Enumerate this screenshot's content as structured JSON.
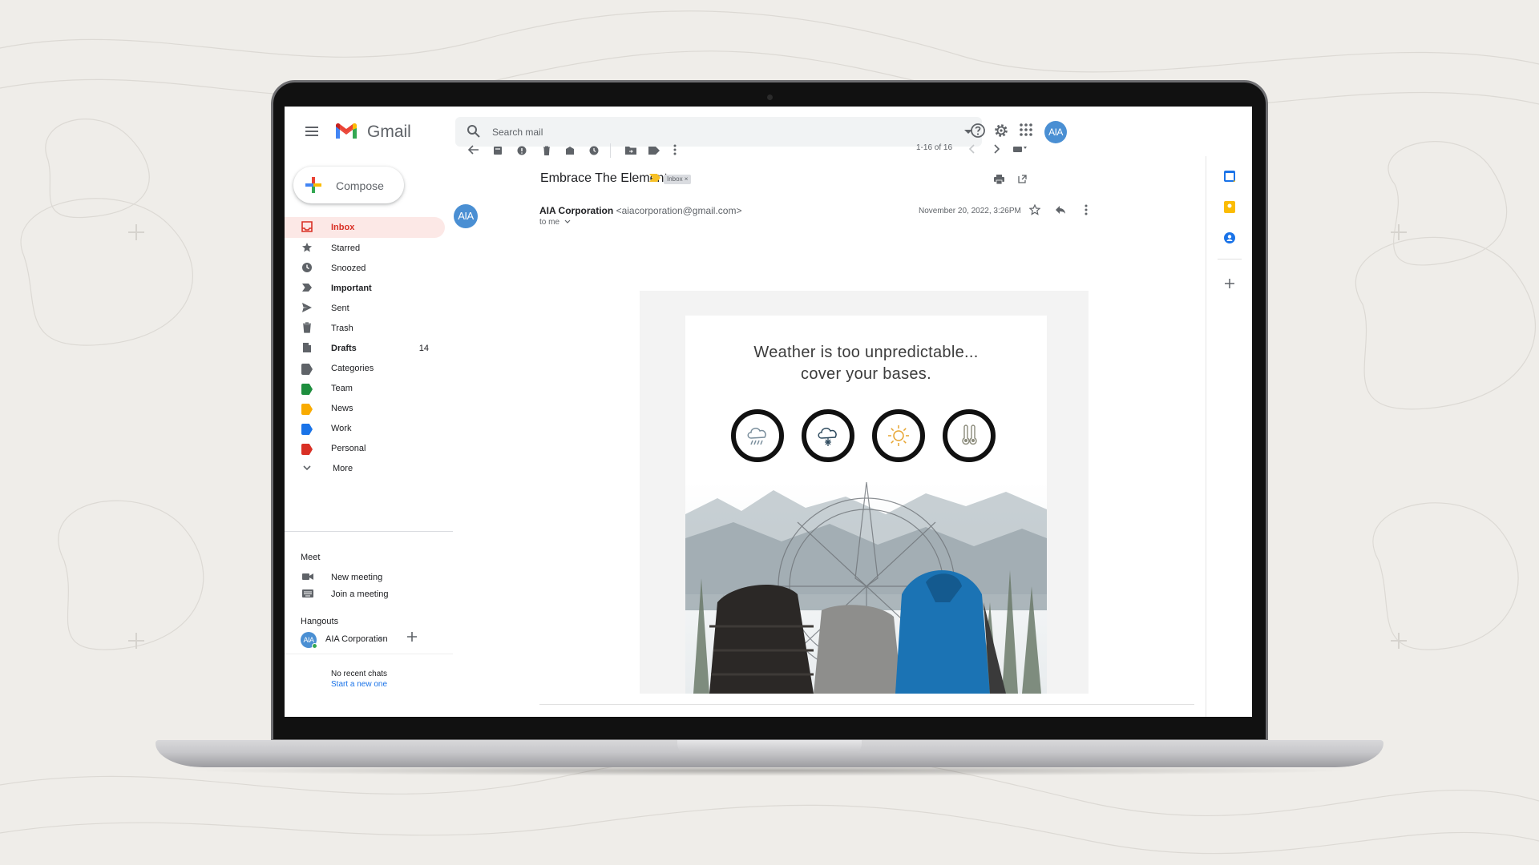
{
  "app": {
    "name": "Gmail",
    "search_placeholder": "Search mail",
    "account_initials": "AIA",
    "compose_label": "Compose"
  },
  "nav": [
    {
      "label": "Inbox",
      "icon": "inbox-icon",
      "active": true,
      "count": ""
    },
    {
      "label": "Starred",
      "icon": "star-icon",
      "count": ""
    },
    {
      "label": "Snoozed",
      "icon": "clock-icon",
      "count": ""
    },
    {
      "label": "Important",
      "icon": "important-icon",
      "bold": true,
      "count": ""
    },
    {
      "label": "Sent",
      "icon": "send-icon",
      "count": ""
    },
    {
      "label": "Trash",
      "icon": "trash-icon",
      "count": ""
    },
    {
      "label": "Drafts",
      "icon": "draft-icon",
      "bold": true,
      "count": "14"
    },
    {
      "label": "Categories",
      "icon": "label-icon",
      "color": "#5f6368",
      "count": ""
    },
    {
      "label": "Team",
      "icon": "label-icon",
      "color": "#1e8e3e",
      "count": ""
    },
    {
      "label": "News",
      "icon": "label-icon",
      "color": "#f9ab00",
      "count": ""
    },
    {
      "label": "Work",
      "icon": "label-icon",
      "color": "#1a73e8",
      "count": ""
    },
    {
      "label": "Personal",
      "icon": "label-icon",
      "color": "#d93025",
      "count": ""
    },
    {
      "label": "More",
      "icon": "chevron-down-icon",
      "count": ""
    }
  ],
  "meet": {
    "title": "Meet",
    "new_meeting": "New meeting",
    "join_meeting": "Join a meeting"
  },
  "hangouts": {
    "title": "Hangouts",
    "contact": "AIA Corporation",
    "contact_initials": "AIA",
    "no_chats": "No recent chats",
    "start_new": "Start a new one"
  },
  "toolbar": {
    "pager": "1-16 of 16"
  },
  "message": {
    "subject": "Embrace The Elements",
    "label_chip": "Inbox ×",
    "sender_name": "AIA Corporation",
    "sender_email": "<aiacorporation@gmail.com>",
    "to": "to me",
    "date": "November 20, 2022, 3:26PM",
    "sender_initials": "AIA"
  },
  "email_body": {
    "headline_line1": "Weather is too unpredictable...",
    "headline_line2": "cover your bases.",
    "weather_icons": [
      "rain-icon",
      "snow-icon",
      "sun-icon",
      "temperature-icon"
    ]
  },
  "colors": {
    "accent_red": "#d93025",
    "inbox_active_bg": "#fce8e6",
    "avatar_blue": "#4a8fd3",
    "important_yellow": "#f6c026"
  }
}
